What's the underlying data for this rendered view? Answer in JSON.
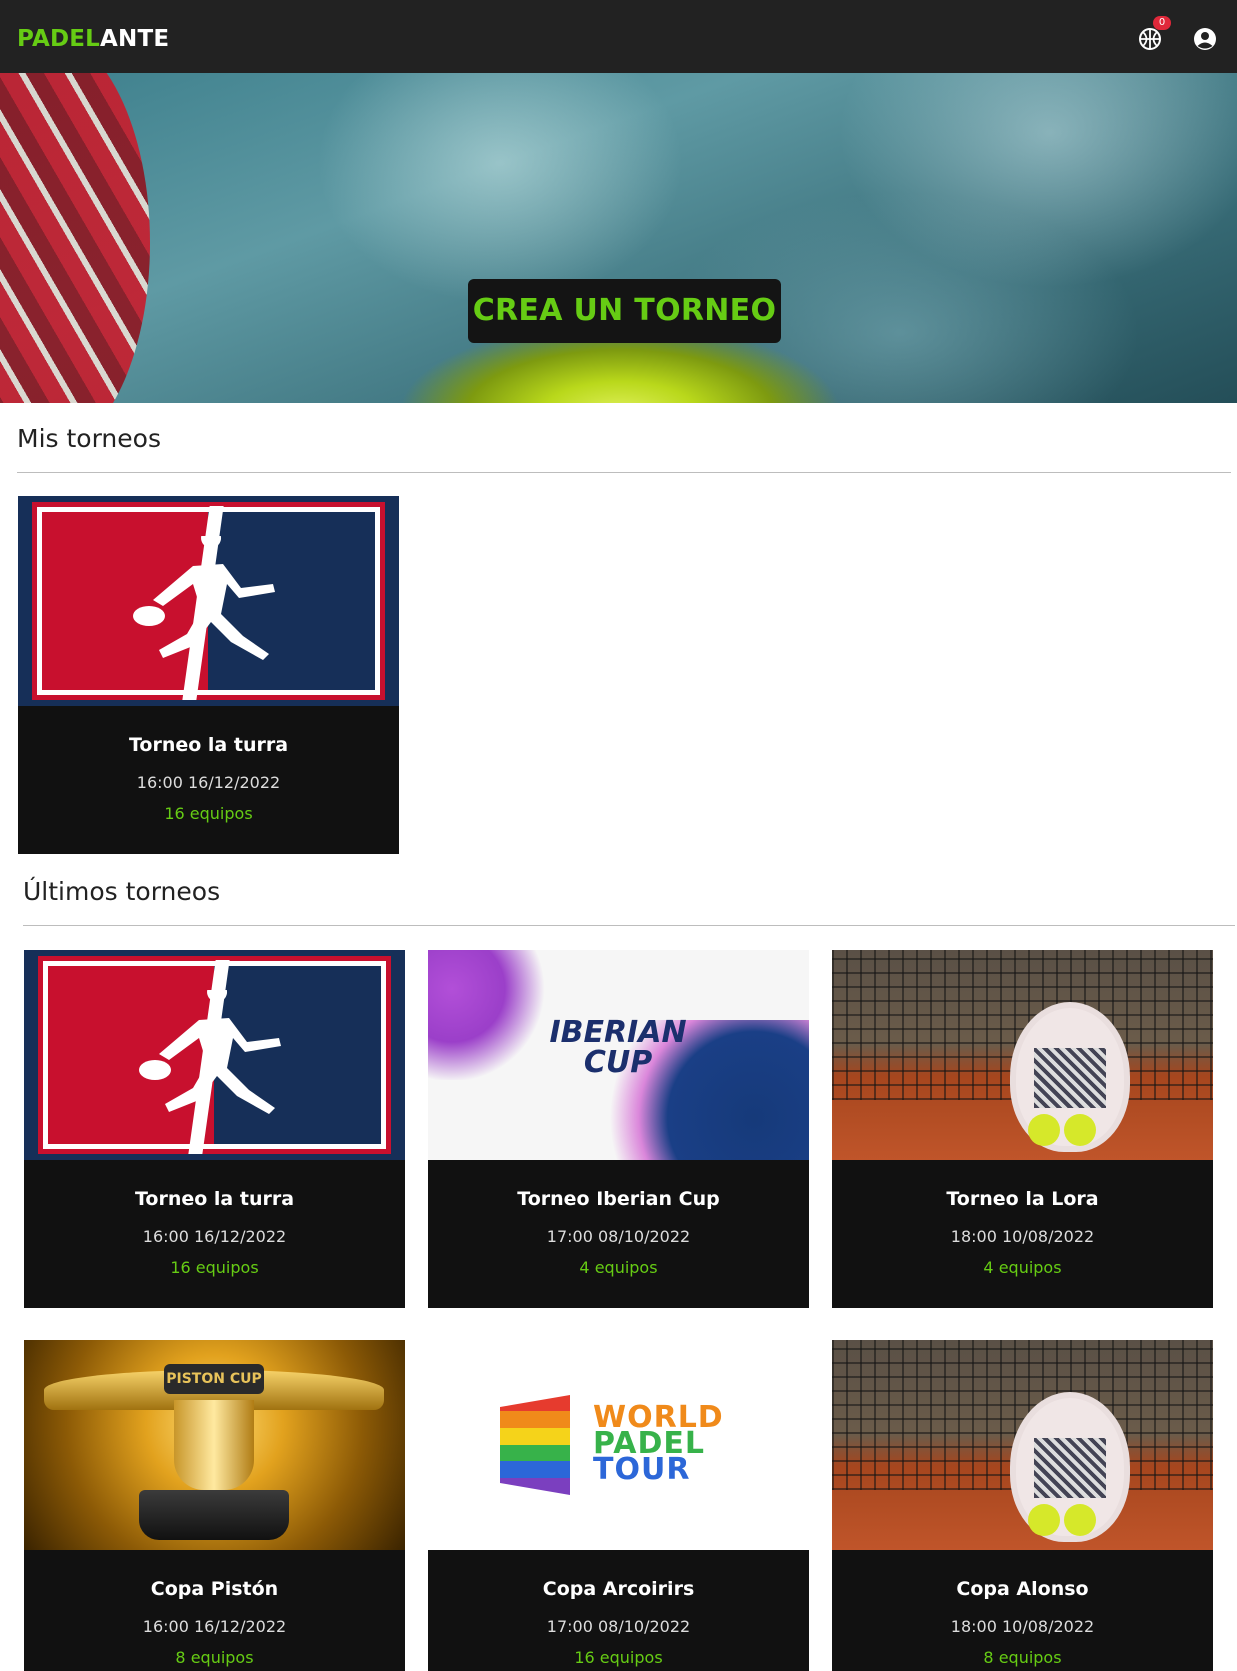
{
  "navbar": {
    "logo_part1": "PADEL",
    "logo_part2": "ANTE",
    "badge_count": "0",
    "icons": [
      "basketball-icon",
      "user-circle-icon"
    ]
  },
  "hero": {
    "button_label": "CREA UN TORNEO"
  },
  "sections": {
    "mine_title": "Mis torneos",
    "latest_title": "Últimos torneos"
  },
  "my_tournaments": [
    {
      "name": "Torneo la turra",
      "datetime": "16:00 16/12/2022",
      "teams": "16 equipos"
    }
  ],
  "latest_tournaments": [
    {
      "name": "Torneo la turra",
      "datetime": "16:00 16/12/2022",
      "teams": "16 equipos"
    },
    {
      "name": "Torneo Iberian Cup",
      "datetime": "17:00 08/10/2022",
      "teams": "4 equipos",
      "logo_text": "IBERIAN CUP"
    },
    {
      "name": "Torneo la Lora",
      "datetime": "18:00 10/08/2022",
      "teams": "4 equipos"
    },
    {
      "name": "Copa Pistón",
      "datetime": "16:00 16/12/2022",
      "teams": "8 equipos",
      "logo_text": "PISTON CUP"
    },
    {
      "name": "Copa Arcoirirs",
      "datetime": "17:00 08/10/2022",
      "teams": "16 equipos",
      "logo_lines": [
        "WORLD",
        "PADEL",
        "TOUR"
      ]
    },
    {
      "name": "Copa Alonso",
      "datetime": "18:00 10/08/2022",
      "teams": "8 equipos"
    }
  ],
  "colors": {
    "accent": "#66cc14",
    "navbar": "#222222",
    "card_bg": "#111111",
    "badge": "#e0283a"
  }
}
